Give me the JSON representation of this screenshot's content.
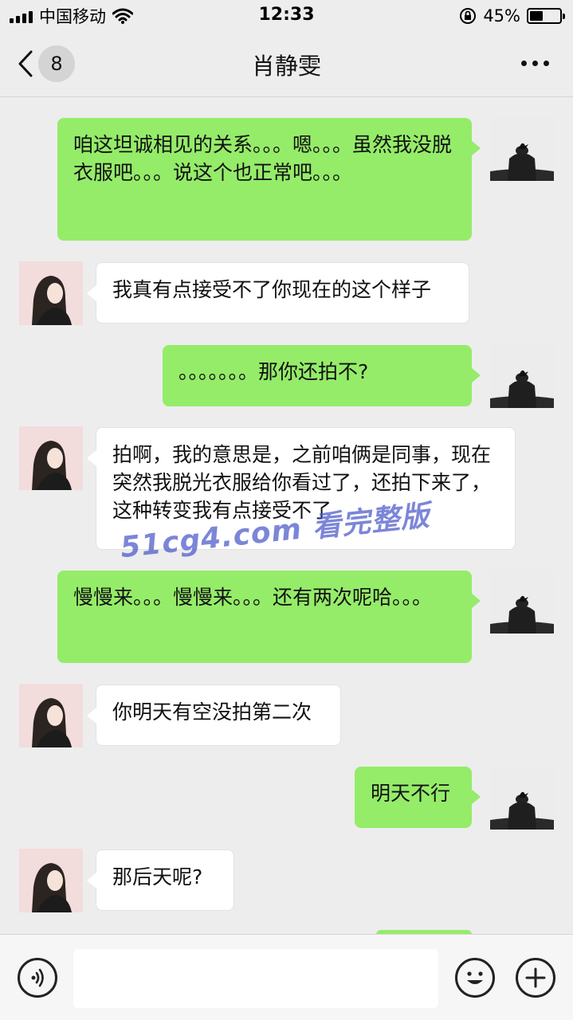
{
  "status_bar": {
    "carrier": "中国移动",
    "time": "12:33",
    "battery_percent": "45%",
    "battery_level": 0.45
  },
  "header": {
    "unread_count": "8",
    "title": "肖静雯"
  },
  "messages": [
    {
      "sender": "self",
      "text": "咱这坦诚相见的关系。。。嗯。。。虽然我没脱衣服吧。。。说这个也正常吧。。。"
    },
    {
      "sender": "peer",
      "text": "我真有点接受不了你现在的这个样子"
    },
    {
      "sender": "self",
      "text": "。。。。。。。那你还拍不?"
    },
    {
      "sender": "peer",
      "text": "拍啊，我的意思是，之前咱俩是同事，现在突然我脱光衣服给你看过了，还拍下来了，这种转变我有点接受不了"
    },
    {
      "sender": "self",
      "text": "慢慢来。。。慢慢来。。。还有两次呢哈。。。"
    },
    {
      "sender": "peer",
      "text": "你明天有空没拍第二次"
    },
    {
      "sender": "self",
      "text": "明天不行"
    },
    {
      "sender": "peer",
      "text": "那后天呢?"
    }
  ],
  "watermark": "51cg4.com 看完整版",
  "input_bar": {
    "voice_icon": "voice-icon",
    "emoji_icon": "emoji-icon",
    "plus_icon": "plus-icon",
    "text_value": ""
  },
  "colors": {
    "self_bubble": "#95ec69",
    "peer_bubble": "#ffffff",
    "background": "#ededed"
  }
}
